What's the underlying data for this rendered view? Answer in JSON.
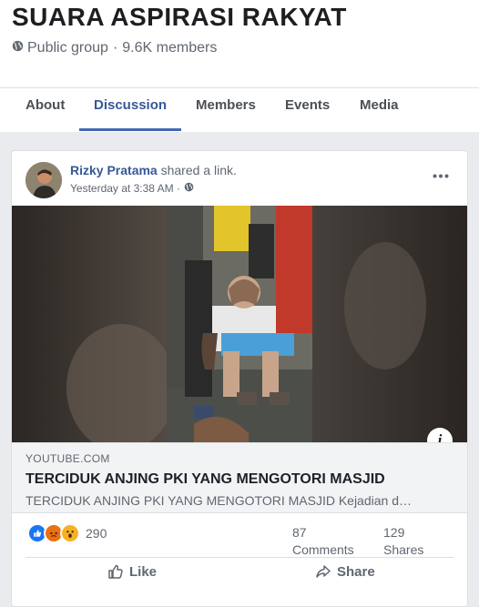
{
  "group": {
    "title": "SUARA ASPIRASI RAKYAT",
    "privacy": "Public group",
    "separator": "·",
    "members": "9.6K members"
  },
  "tabs": [
    {
      "label": "About"
    },
    {
      "label": "Discussion"
    },
    {
      "label": "Members"
    },
    {
      "label": "Events"
    },
    {
      "label": "Media"
    }
  ],
  "post": {
    "author": "Rizky Pratama",
    "action": "shared a link.",
    "timestamp": "Yesterday at 3:38 AM ·",
    "link": {
      "domain": "YOUTUBE.COM",
      "title": "TERCIDUK ANJING PKI YANG MENGOTORI MASJID",
      "description": "TERCIDUK ANJING PKI YANG MENGOTORI MASJID Kejadian d…"
    },
    "reaction_count": "290",
    "comments_count": "87",
    "comments_label": "Comments",
    "shares_count": "129",
    "shares_label": "Shares",
    "like_label": "Like",
    "share_label": "Share"
  },
  "icons": {
    "globe": "globe-icon",
    "more": "more-horizontal-icon",
    "info": "info-icon",
    "like_reaction": "like-reaction-icon",
    "angry_reaction": "angry-reaction-icon",
    "wow_reaction": "wow-reaction-icon",
    "thumb": "thumbs-up-icon",
    "share": "share-arrow-icon"
  },
  "colors": {
    "accent": "#4267b2",
    "link_name": "#385898",
    "like_blue": "#1877f2",
    "angry": "#e9710f",
    "wow": "#f7b125"
  }
}
